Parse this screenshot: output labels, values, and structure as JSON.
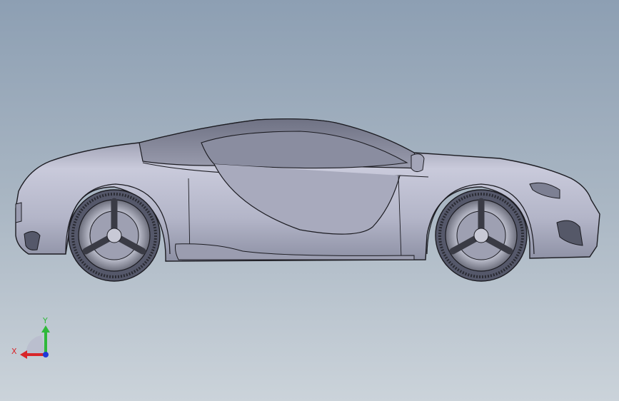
{
  "viewport": {
    "background_top": "#8d9fb3",
    "background_bottom": "#cbd3da",
    "model_color": "#b9bccd",
    "edge_color": "#1c1c22"
  },
  "triad": {
    "x_label": "X",
    "y_label": "Y",
    "x_color": "#d8262a",
    "y_color": "#2fb83a",
    "z_color": "#1e3ad8"
  }
}
